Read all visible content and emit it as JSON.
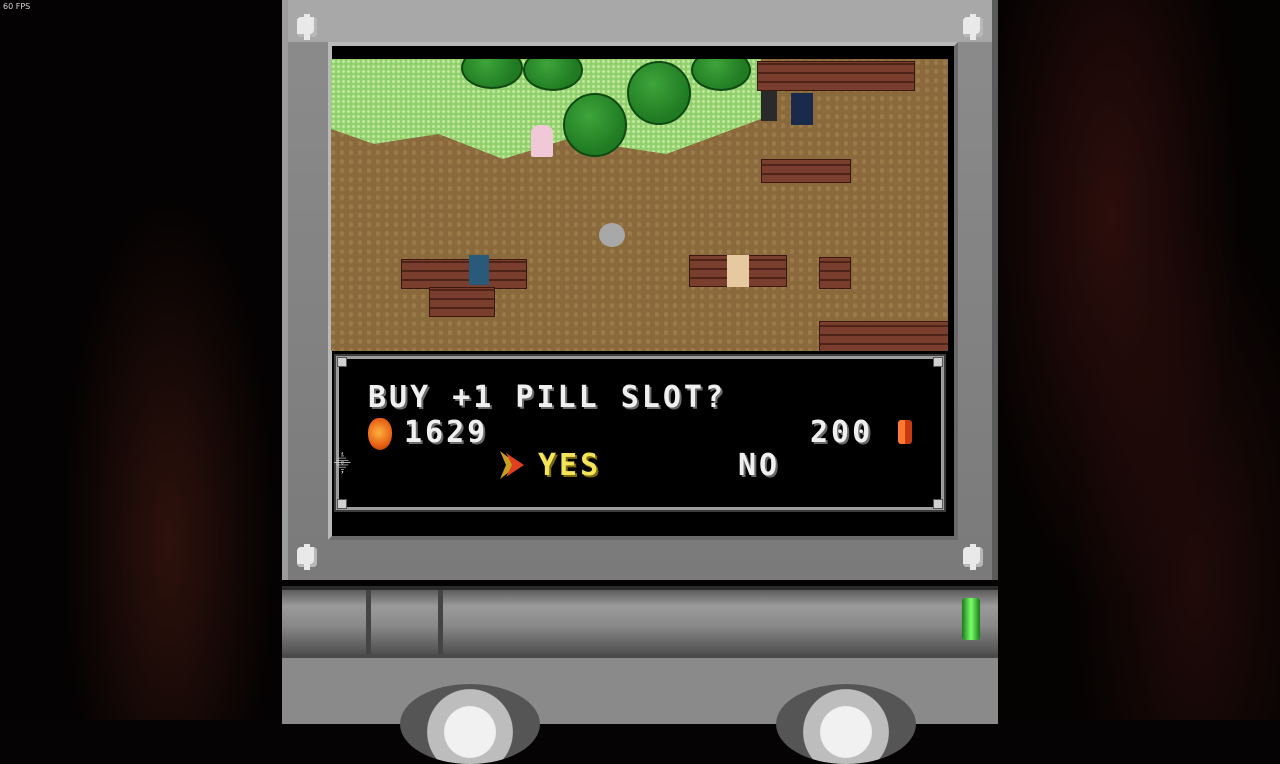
{
  "fps_counter": "60 FPS",
  "dialog": {
    "question": "BUY +1 PILL SLOT?",
    "currency_amount": "1629",
    "price": "200",
    "options": {
      "yes": "YES",
      "no": "NO"
    },
    "selected_option": "yes"
  },
  "icons": {
    "currency": "orange-orb-icon",
    "price": "pill-icon",
    "cursor": "arrow-cursor-icon",
    "corner": "sparkle-icon"
  },
  "colors": {
    "selected_text": "#f3e45a",
    "default_text": "#f0f0f0",
    "led": "#7aff6a"
  }
}
